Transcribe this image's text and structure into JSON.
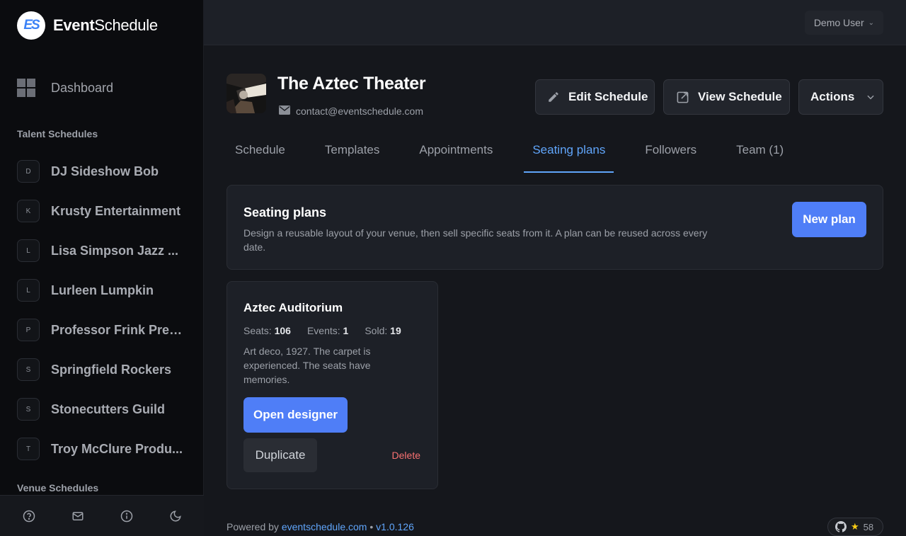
{
  "brand": {
    "logo_text": "ES",
    "name_bold": "Event",
    "name_rest": "Schedule"
  },
  "sidebar": {
    "dashboard_label": "Dashboard",
    "talent_title": "Talent Schedules",
    "talent": [
      {
        "initial": "D",
        "name": "DJ Sideshow Bob"
      },
      {
        "initial": "K",
        "name": "Krusty Entertainment"
      },
      {
        "initial": "L",
        "name": "Lisa Simpson Jazz ..."
      },
      {
        "initial": "L",
        "name": "Lurleen Lumpkin"
      },
      {
        "initial": "P",
        "name": "Professor Frink Pres..."
      },
      {
        "initial": "S",
        "name": "Springfield Rockers"
      },
      {
        "initial": "S",
        "name": "Stonecutters Guild"
      },
      {
        "initial": "T",
        "name": "Troy McClure Produ..."
      }
    ],
    "venue_title": "Venue Schedules"
  },
  "topbar": {
    "user": "Demo User"
  },
  "header": {
    "title": "The Aztec Theater",
    "email": "contact@eventschedule.com",
    "edit_label": "Edit Schedule",
    "view_label": "View Schedule",
    "actions_label": "Actions"
  },
  "tabs": [
    {
      "label": "Schedule",
      "active": false
    },
    {
      "label": "Templates",
      "active": false
    },
    {
      "label": "Appointments",
      "active": false
    },
    {
      "label": "Seating plans",
      "active": true
    },
    {
      "label": "Followers",
      "active": false
    },
    {
      "label": "Team (1)",
      "active": false
    }
  ],
  "info": {
    "title": "Seating plans",
    "description": "Design a reusable layout of your venue, then sell specific seats from it. A plan can be reused across every date.",
    "new_label": "New plan"
  },
  "plan": {
    "title": "Aztec Auditorium",
    "seats_label": "Seats:",
    "seats": "106",
    "events_label": "Events:",
    "events": "1",
    "sold_label": "Sold:",
    "sold": "19",
    "description": "Art deco, 1927. The carpet is experienced. The seats have memories.",
    "open_label": "Open designer",
    "duplicate_label": "Duplicate",
    "delete_label": "Delete"
  },
  "footer": {
    "powered": "Powered by",
    "site": "eventschedule.com",
    "sep": "•",
    "version": "v1.0.126",
    "stars": "58"
  },
  "colors": {
    "accent": "#4f7ef7",
    "link": "#60a5fa",
    "danger": "#f87171",
    "star": "#facc15"
  }
}
